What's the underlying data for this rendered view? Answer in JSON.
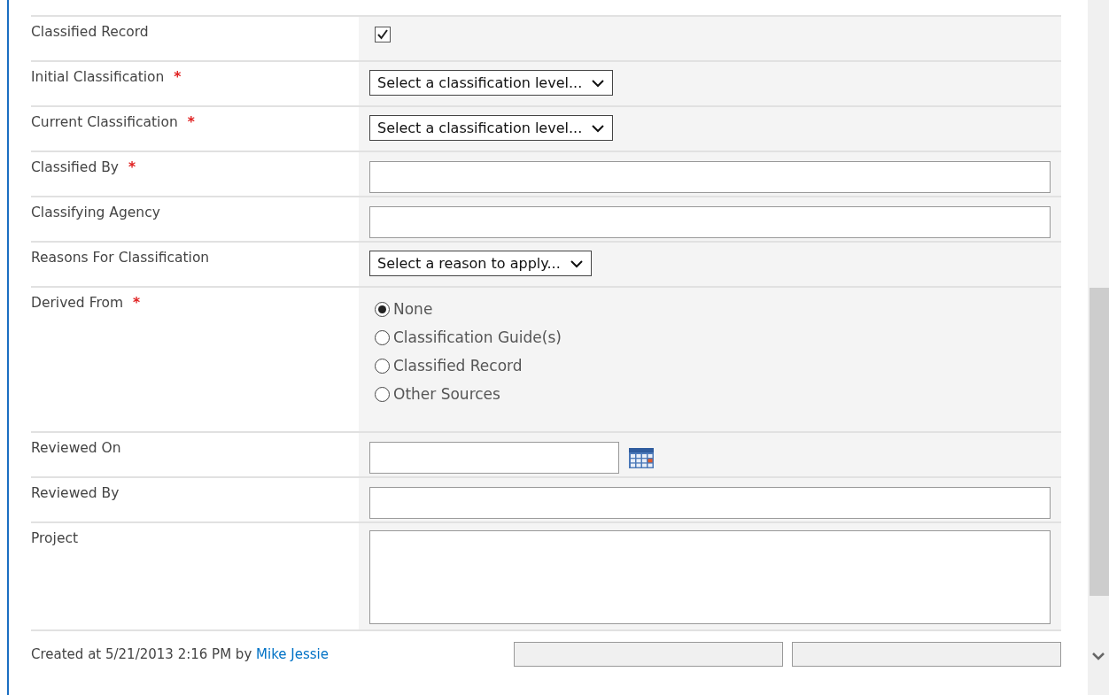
{
  "fields": [
    {
      "kind": "checkbox",
      "label": "Classified Record",
      "checked": true
    },
    {
      "kind": "select",
      "label": "Initial Classification",
      "required_mark": "*",
      "value": "Select a classification level..."
    },
    {
      "kind": "select",
      "label": "Current Classification",
      "required_mark": "*",
      "value": "Select a classification level..."
    },
    {
      "kind": "text",
      "label": "Classified By",
      "required_mark": "*"
    },
    {
      "kind": "text",
      "label": "Classifying Agency"
    },
    {
      "kind": "select",
      "label": "Reasons For Classification",
      "value": "Select a reason to apply..."
    },
    {
      "kind": "radio",
      "label": "Derived From",
      "required_mark": "*",
      "options": [
        {
          "label": "None",
          "selected": true
        },
        {
          "label": "Classification Guide(s)",
          "selected": false
        },
        {
          "label": "Classified Record",
          "selected": false
        },
        {
          "label": "Other Sources",
          "selected": false
        }
      ]
    },
    {
      "kind": "date",
      "label": "Reviewed On"
    },
    {
      "kind": "text",
      "label": "Reviewed By"
    },
    {
      "kind": "textarea",
      "label": "Project"
    }
  ],
  "footer": {
    "text": "Created at 5/21/2013 2:16 PM by",
    "author": "Mike Jessie"
  }
}
